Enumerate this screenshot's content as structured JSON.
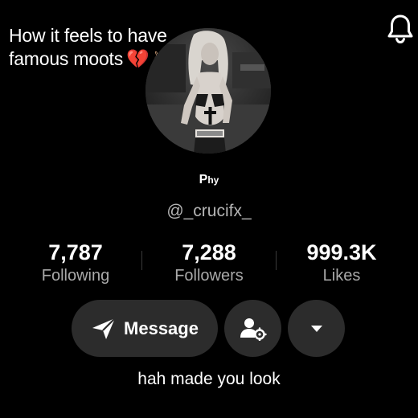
{
  "caption": {
    "line1": "How it feels to have",
    "line2": "famous moots",
    "emoji_heart": "💔",
    "emoji_hand": "✌"
  },
  "header": {
    "bell_icon": "bell-icon"
  },
  "profile": {
    "display_name_main": "P",
    "display_name_small": "hy",
    "username": "@_crucifx_",
    "bio": "hah made you look"
  },
  "stats": {
    "following": {
      "value": "7,787",
      "label": "Following"
    },
    "followers": {
      "value": "7,288",
      "label": "Followers"
    },
    "likes": {
      "value": "999.3K",
      "label": "Likes"
    }
  },
  "actions": {
    "message_label": "Message",
    "message_icon": "send-icon",
    "add_friend_icon": "user-settings-icon",
    "more_icon": "caret-down-icon"
  },
  "colors": {
    "background": "#000000",
    "button_bg": "#2c2c2c",
    "secondary_text": "#a9a9a9"
  }
}
